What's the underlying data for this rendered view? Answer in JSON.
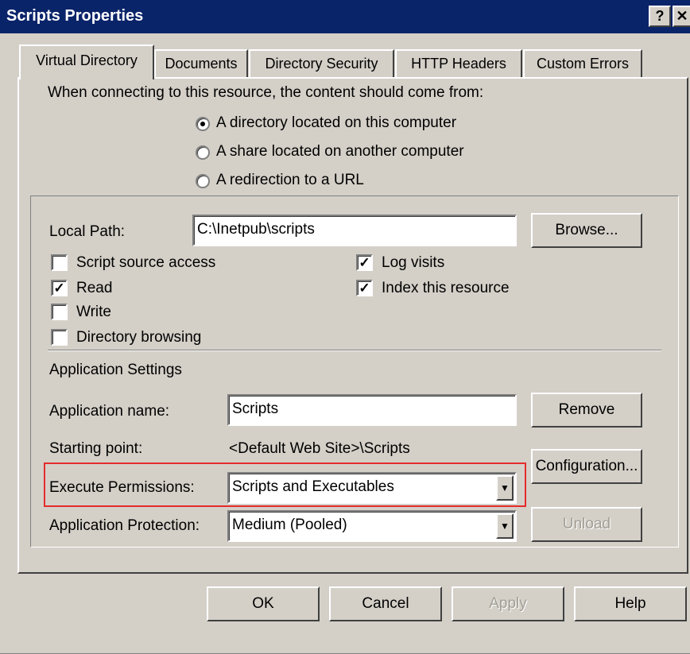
{
  "window": {
    "title": "Scripts Properties",
    "help_glyph": "?",
    "close_glyph": "✕"
  },
  "tabs": [
    {
      "label": "Virtual Directory",
      "active": true
    },
    {
      "label": "Documents",
      "active": false
    },
    {
      "label": "Directory Security",
      "active": false
    },
    {
      "label": "HTTP Headers",
      "active": false
    },
    {
      "label": "Custom Errors",
      "active": false
    }
  ],
  "source": {
    "prompt": "When connecting to this resource, the content should come from:",
    "options": [
      {
        "label": "A directory located on this computer",
        "selected": true
      },
      {
        "label": "A share located on another computer",
        "selected": false
      },
      {
        "label": "A redirection to a URL",
        "selected": false
      }
    ]
  },
  "local_path": {
    "label": "Local Path:",
    "value": "C:\\Inetpub\\scripts",
    "browse_label": "Browse..."
  },
  "checkboxes_left": [
    {
      "label": "Script source access",
      "checked": false
    },
    {
      "label": "Read",
      "checked": true
    },
    {
      "label": "Write",
      "checked": false
    },
    {
      "label": "Directory browsing",
      "checked": false
    }
  ],
  "checkboxes_right": [
    {
      "label": "Log visits",
      "checked": true
    },
    {
      "label": "Index this resource",
      "checked": true
    }
  ],
  "app_settings": {
    "heading": "Application Settings",
    "name_label": "Application name:",
    "name_value": "Scripts",
    "remove_label": "Remove",
    "starting_point_label": "Starting point:",
    "starting_point_value": "<Default Web Site>\\Scripts",
    "configuration_label": "Configuration...",
    "execute_label": "Execute Permissions:",
    "execute_value": "Scripts and Executables",
    "protection_label": "Application Protection:",
    "protection_value": "Medium (Pooled)",
    "unload_label": "Unload"
  },
  "footer": {
    "ok": "OK",
    "cancel": "Cancel",
    "apply": "Apply",
    "help": "Help"
  },
  "check_glyph": "✓",
  "dropdown_glyph": "▼",
  "highlight_color": "#e52b2b",
  "titlebar_color": "#0a246a"
}
